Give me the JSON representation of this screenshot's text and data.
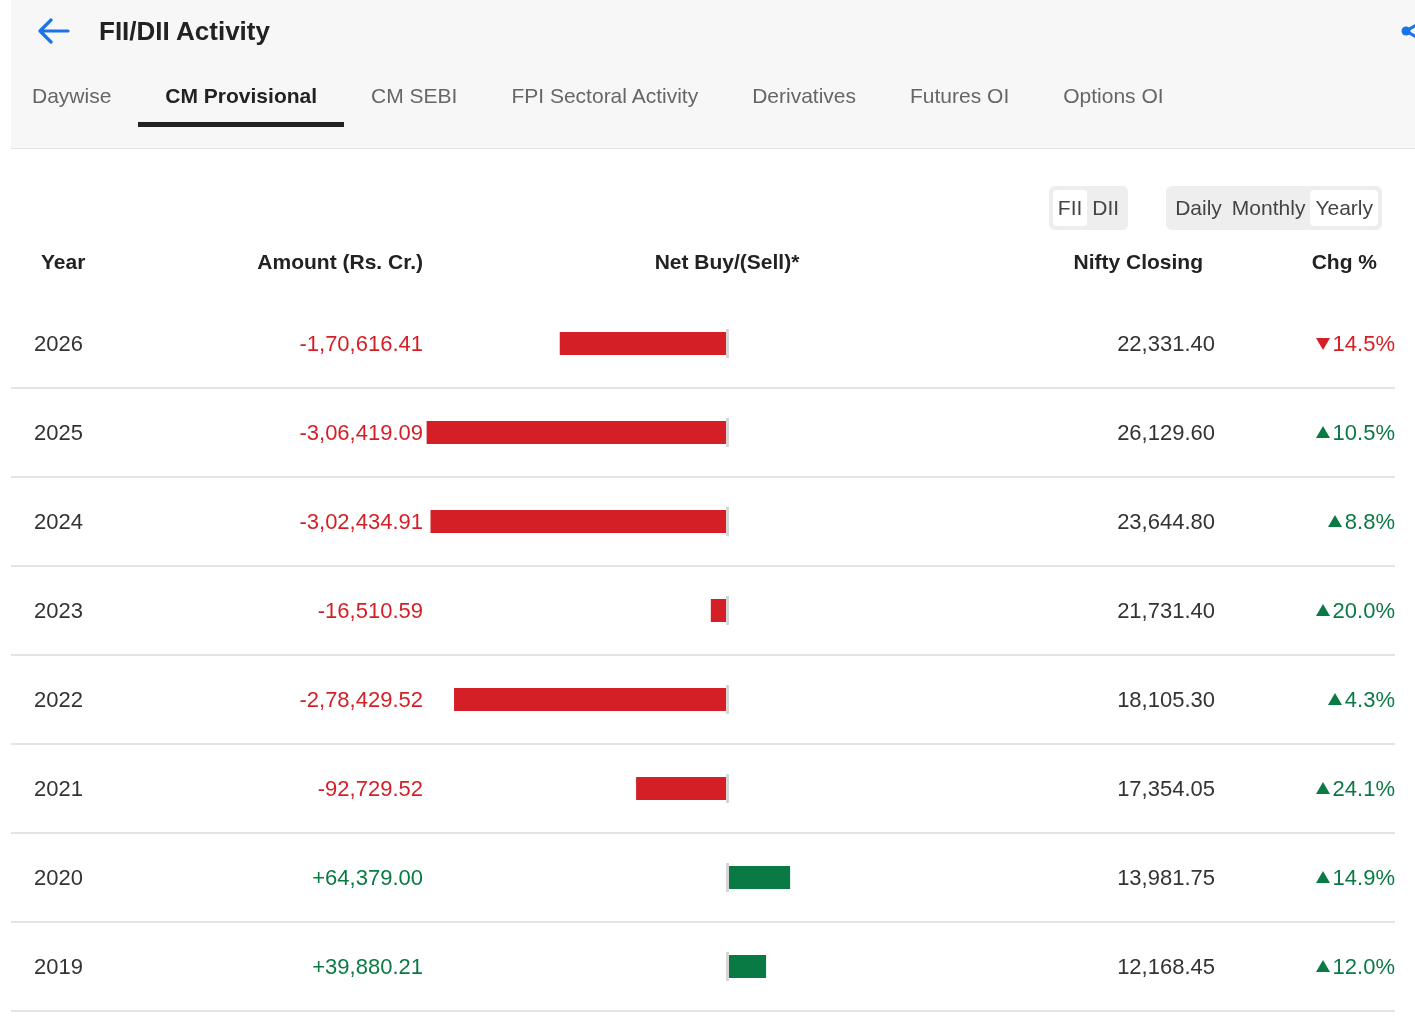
{
  "header": {
    "title": "FII/DII Activity"
  },
  "tabs": [
    {
      "label": "Daywise",
      "selected": false
    },
    {
      "label": "CM Provisional",
      "selected": true
    },
    {
      "label": "CM SEBI",
      "selected": false
    },
    {
      "label": "FPI Sectoral Activity",
      "selected": false
    },
    {
      "label": "Derivatives",
      "selected": false
    },
    {
      "label": "Futures OI",
      "selected": false
    },
    {
      "label": "Options OI",
      "selected": false
    }
  ],
  "investor_toggle": [
    {
      "label": "FII",
      "selected": true
    },
    {
      "label": "DII",
      "selected": false
    }
  ],
  "period_toggle": [
    {
      "label": "Daily",
      "selected": false
    },
    {
      "label": "Monthly",
      "selected": false
    },
    {
      "label": "Yearly",
      "selected": true
    }
  ],
  "columns": [
    "Year",
    "Amount (Rs. Cr.)",
    "Net Buy/(Sell)*",
    "Nifty Closing",
    "Chg %"
  ],
  "rows": [
    {
      "nifty": "22,331.40",
      "rising": false,
      "change": "14.5%"
    },
    {
      "nifty": "26,129.60",
      "rising": true,
      "change": "10.5%"
    },
    {
      "nifty": "23,644.80",
      "rising": true,
      "change": "8.8%"
    },
    {
      "nifty": "21,731.40",
      "rising": true,
      "change": "20.0%"
    },
    {
      "nifty": "18,105.30",
      "rising": true,
      "change": "4.3%"
    },
    {
      "nifty": "17,354.05",
      "rising": true,
      "change": "24.1%"
    },
    {
      "nifty": "13,981.75",
      "rising": true,
      "change": "14.9%"
    },
    {
      "nifty": "12,168.45",
      "rising": true,
      "change": "12.0%"
    }
  ],
  "chart_data": {
    "type": "bar",
    "orientation": "horizontal",
    "categories": [
      "2026",
      "2025",
      "2024",
      "2023",
      "2022",
      "2021",
      "2020",
      "2019"
    ],
    "values": [
      -170616.41,
      -306419.09,
      -302434.91,
      -16510.59,
      -278429.52,
      -92729.52,
      64379.0,
      39880.21
    ],
    "value_labels": [
      "-1,70,616.41",
      "-3,06,419.09",
      "-3,02,434.91",
      "-16,510.59",
      "-2,78,429.52",
      "-92,729.52",
      "+64,379.00",
      "+39,880.21"
    ]
  }
}
